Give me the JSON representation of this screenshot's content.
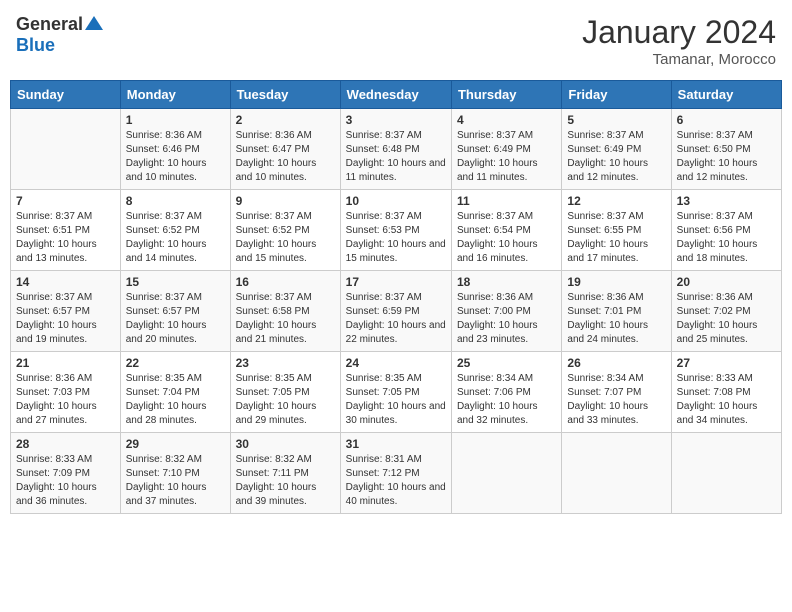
{
  "header": {
    "logo_general": "General",
    "logo_blue": "Blue",
    "title": "January 2024",
    "subtitle": "Tamanar, Morocco"
  },
  "days_of_week": [
    "Sunday",
    "Monday",
    "Tuesday",
    "Wednesday",
    "Thursday",
    "Friday",
    "Saturday"
  ],
  "weeks": [
    [
      {
        "day": "",
        "info": ""
      },
      {
        "day": "1",
        "info": "Sunrise: 8:36 AM\nSunset: 6:46 PM\nDaylight: 10 hours and 10 minutes."
      },
      {
        "day": "2",
        "info": "Sunrise: 8:36 AM\nSunset: 6:47 PM\nDaylight: 10 hours and 10 minutes."
      },
      {
        "day": "3",
        "info": "Sunrise: 8:37 AM\nSunset: 6:48 PM\nDaylight: 10 hours and 11 minutes."
      },
      {
        "day": "4",
        "info": "Sunrise: 8:37 AM\nSunset: 6:49 PM\nDaylight: 10 hours and 11 minutes."
      },
      {
        "day": "5",
        "info": "Sunrise: 8:37 AM\nSunset: 6:49 PM\nDaylight: 10 hours and 12 minutes."
      },
      {
        "day": "6",
        "info": "Sunrise: 8:37 AM\nSunset: 6:50 PM\nDaylight: 10 hours and 12 minutes."
      }
    ],
    [
      {
        "day": "7",
        "info": "Sunrise: 8:37 AM\nSunset: 6:51 PM\nDaylight: 10 hours and 13 minutes."
      },
      {
        "day": "8",
        "info": "Sunrise: 8:37 AM\nSunset: 6:52 PM\nDaylight: 10 hours and 14 minutes."
      },
      {
        "day": "9",
        "info": "Sunrise: 8:37 AM\nSunset: 6:52 PM\nDaylight: 10 hours and 15 minutes."
      },
      {
        "day": "10",
        "info": "Sunrise: 8:37 AM\nSunset: 6:53 PM\nDaylight: 10 hours and 15 minutes."
      },
      {
        "day": "11",
        "info": "Sunrise: 8:37 AM\nSunset: 6:54 PM\nDaylight: 10 hours and 16 minutes."
      },
      {
        "day": "12",
        "info": "Sunrise: 8:37 AM\nSunset: 6:55 PM\nDaylight: 10 hours and 17 minutes."
      },
      {
        "day": "13",
        "info": "Sunrise: 8:37 AM\nSunset: 6:56 PM\nDaylight: 10 hours and 18 minutes."
      }
    ],
    [
      {
        "day": "14",
        "info": "Sunrise: 8:37 AM\nSunset: 6:57 PM\nDaylight: 10 hours and 19 minutes."
      },
      {
        "day": "15",
        "info": "Sunrise: 8:37 AM\nSunset: 6:57 PM\nDaylight: 10 hours and 20 minutes."
      },
      {
        "day": "16",
        "info": "Sunrise: 8:37 AM\nSunset: 6:58 PM\nDaylight: 10 hours and 21 minutes."
      },
      {
        "day": "17",
        "info": "Sunrise: 8:37 AM\nSunset: 6:59 PM\nDaylight: 10 hours and 22 minutes."
      },
      {
        "day": "18",
        "info": "Sunrise: 8:36 AM\nSunset: 7:00 PM\nDaylight: 10 hours and 23 minutes."
      },
      {
        "day": "19",
        "info": "Sunrise: 8:36 AM\nSunset: 7:01 PM\nDaylight: 10 hours and 24 minutes."
      },
      {
        "day": "20",
        "info": "Sunrise: 8:36 AM\nSunset: 7:02 PM\nDaylight: 10 hours and 25 minutes."
      }
    ],
    [
      {
        "day": "21",
        "info": "Sunrise: 8:36 AM\nSunset: 7:03 PM\nDaylight: 10 hours and 27 minutes."
      },
      {
        "day": "22",
        "info": "Sunrise: 8:35 AM\nSunset: 7:04 PM\nDaylight: 10 hours and 28 minutes."
      },
      {
        "day": "23",
        "info": "Sunrise: 8:35 AM\nSunset: 7:05 PM\nDaylight: 10 hours and 29 minutes."
      },
      {
        "day": "24",
        "info": "Sunrise: 8:35 AM\nSunset: 7:05 PM\nDaylight: 10 hours and 30 minutes."
      },
      {
        "day": "25",
        "info": "Sunrise: 8:34 AM\nSunset: 7:06 PM\nDaylight: 10 hours and 32 minutes."
      },
      {
        "day": "26",
        "info": "Sunrise: 8:34 AM\nSunset: 7:07 PM\nDaylight: 10 hours and 33 minutes."
      },
      {
        "day": "27",
        "info": "Sunrise: 8:33 AM\nSunset: 7:08 PM\nDaylight: 10 hours and 34 minutes."
      }
    ],
    [
      {
        "day": "28",
        "info": "Sunrise: 8:33 AM\nSunset: 7:09 PM\nDaylight: 10 hours and 36 minutes."
      },
      {
        "day": "29",
        "info": "Sunrise: 8:32 AM\nSunset: 7:10 PM\nDaylight: 10 hours and 37 minutes."
      },
      {
        "day": "30",
        "info": "Sunrise: 8:32 AM\nSunset: 7:11 PM\nDaylight: 10 hours and 39 minutes."
      },
      {
        "day": "31",
        "info": "Sunrise: 8:31 AM\nSunset: 7:12 PM\nDaylight: 10 hours and 40 minutes."
      },
      {
        "day": "",
        "info": ""
      },
      {
        "day": "",
        "info": ""
      },
      {
        "day": "",
        "info": ""
      }
    ]
  ]
}
